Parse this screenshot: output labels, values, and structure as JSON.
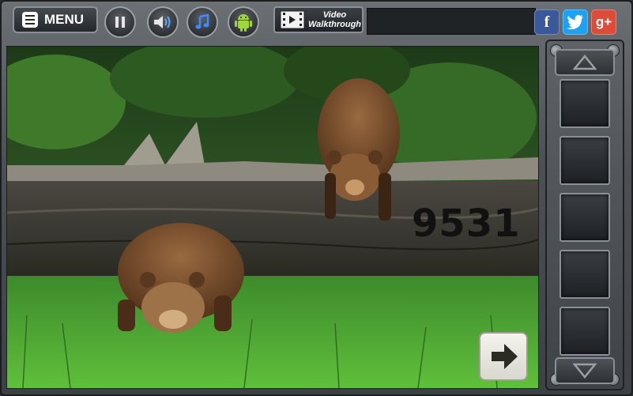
{
  "toolbar": {
    "menu_label": "MENU",
    "video_line1": "Video",
    "video_line2": "Walkthrough"
  },
  "icons": {
    "menu": "menu-icon",
    "pause": "pause-icon",
    "sound": "speaker-icon",
    "music": "music-note-icon",
    "android": "android-icon",
    "video": "film-icon",
    "facebook": "facebook-icon",
    "twitter": "twitter-icon",
    "googleplus": "google-plus-icon",
    "next": "arrow-right-icon",
    "up": "arrow-up-icon",
    "down": "arrow-down-icon"
  },
  "social": {
    "facebook_label": "f",
    "googleplus_label": "g+"
  },
  "colors": {
    "facebook": "#3b5998",
    "twitter": "#1da1f2",
    "googleplus": "#dd4b39"
  },
  "scene": {
    "clue_code": "9531"
  },
  "inventory": {
    "slots": [
      "",
      "",
      "",
      "",
      ""
    ]
  }
}
